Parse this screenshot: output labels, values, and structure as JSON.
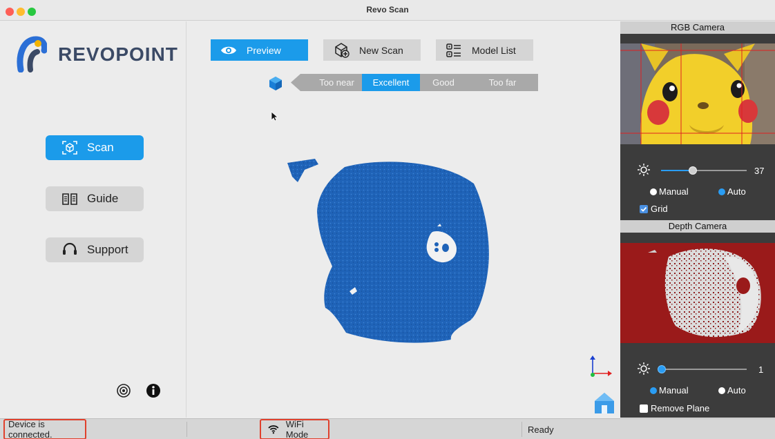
{
  "window": {
    "title": "Revo Scan"
  },
  "sidebar": {
    "brand": "REVOPOINT",
    "nav": [
      {
        "label": "Scan",
        "active": true
      },
      {
        "label": "Guide",
        "active": false
      },
      {
        "label": "Support",
        "active": false
      }
    ]
  },
  "toolbar": {
    "preview_label": "Preview",
    "new_scan_label": "New Scan",
    "model_list_label": "Model List"
  },
  "distance": {
    "segments": [
      "Too near",
      "Excellent",
      "Good",
      "Too far"
    ],
    "selected": "Excellent"
  },
  "rgb_camera": {
    "title": "RGB Camera",
    "brightness": 37,
    "brightness_max": 100,
    "mode_manual": "Manual",
    "mode_auto": "Auto",
    "selected_mode": "Auto",
    "grid_label": "Grid",
    "grid_checked": true
  },
  "depth_camera": {
    "title": "Depth Camera",
    "exposure": 1,
    "exposure_max": 100,
    "mode_manual": "Manual",
    "mode_auto": "Auto",
    "selected_mode": "Manual",
    "remove_plane_label": "Remove Plane",
    "remove_plane_checked": false
  },
  "status": {
    "connection": "Device is connected.",
    "mode": "WiFi Mode",
    "state": "Ready"
  },
  "colors": {
    "accent": "#1b9bea",
    "point_cloud": "#1f63b8",
    "depth_bg": "#9a1a1a",
    "highlight": "#e0402c"
  }
}
